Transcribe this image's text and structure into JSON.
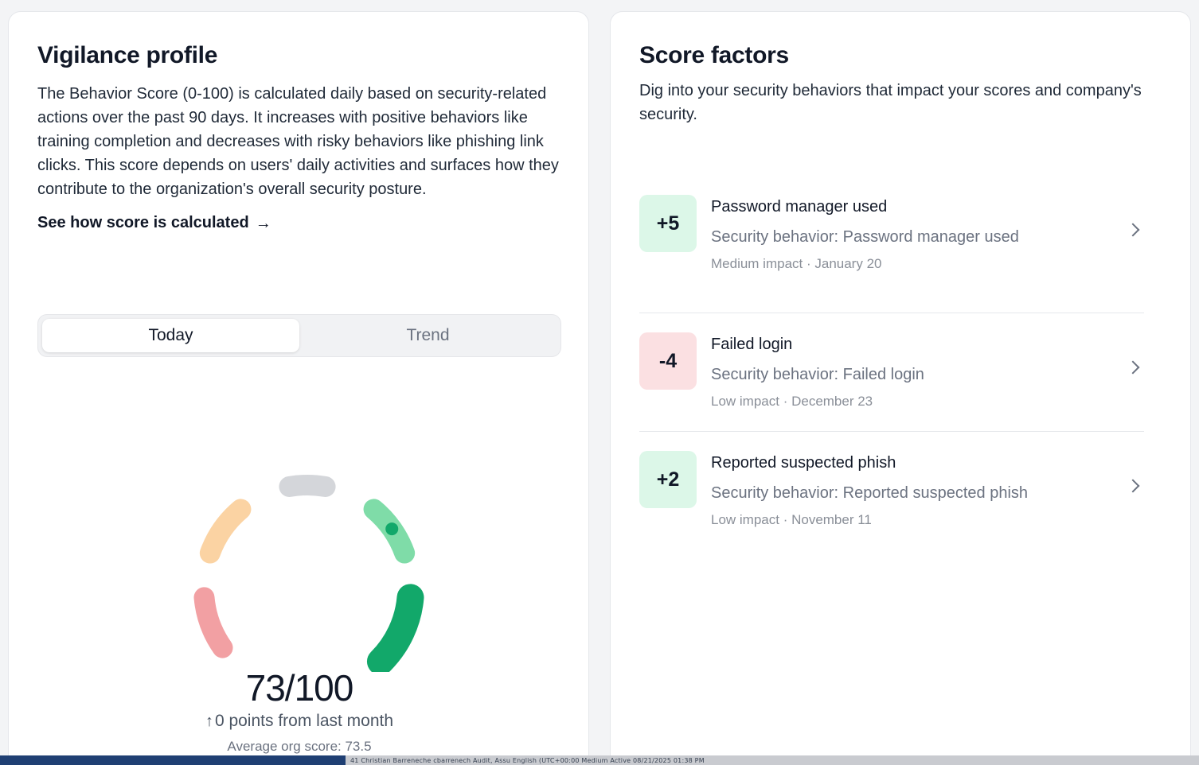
{
  "left_card": {
    "title": "Vigilance profile",
    "description": "The Behavior Score (0-100) is calculated daily based on security-related actions over the past 90 days. It increases with positive behaviors like training completion and decreases with risky behaviors like phishing link clicks. This score depends on users' daily activities and surfaces how they contribute to the organization's overall security posture.",
    "link_label": "See how score is calculated",
    "link_arrow": "→",
    "tabs": [
      {
        "label": "Today",
        "active": true
      },
      {
        "label": "Trend",
        "active": false
      }
    ],
    "gauge": {
      "score": 73,
      "max": 100,
      "segment_colors": [
        "#f2a0a3",
        "#fbd3a3",
        "#d4d6da",
        "#7fdca8",
        "#12a86a"
      ],
      "indicator_color": "#12a86a"
    },
    "score_label": "73/100",
    "change_arrow": "↑",
    "change_label": "0 points from last month",
    "average_label": "Average org score: 73.5"
  },
  "right_card": {
    "title": "Score factors",
    "subtitle": "Dig into your security behaviors that impact your scores and company's security.",
    "factors": [
      {
        "badge": "+5",
        "tone": "positive",
        "title": "Password manager used",
        "subtitle": "Security behavior: Password manager used",
        "meta": "Medium impact · January 20"
      },
      {
        "badge": "-4",
        "tone": "negative",
        "title": "Failed login",
        "subtitle": "Security behavior: Failed login",
        "meta": "Low impact · December 23"
      },
      {
        "badge": "+2",
        "tone": "positive",
        "title": "Reported suspected phish",
        "subtitle": "Security behavior: Reported suspected phish",
        "meta": "Low impact · November 11"
      }
    ]
  },
  "colors": {
    "positive_badge": "#dcf7e8",
    "negative_badge": "#fbe0e2"
  },
  "taskbar": {
    "text": "41   Christian    Barreneche cbarrenech                              Audit, Assu English      (UTC+00:00 Medium      Active                              08/21/2025 01:38 PM"
  }
}
